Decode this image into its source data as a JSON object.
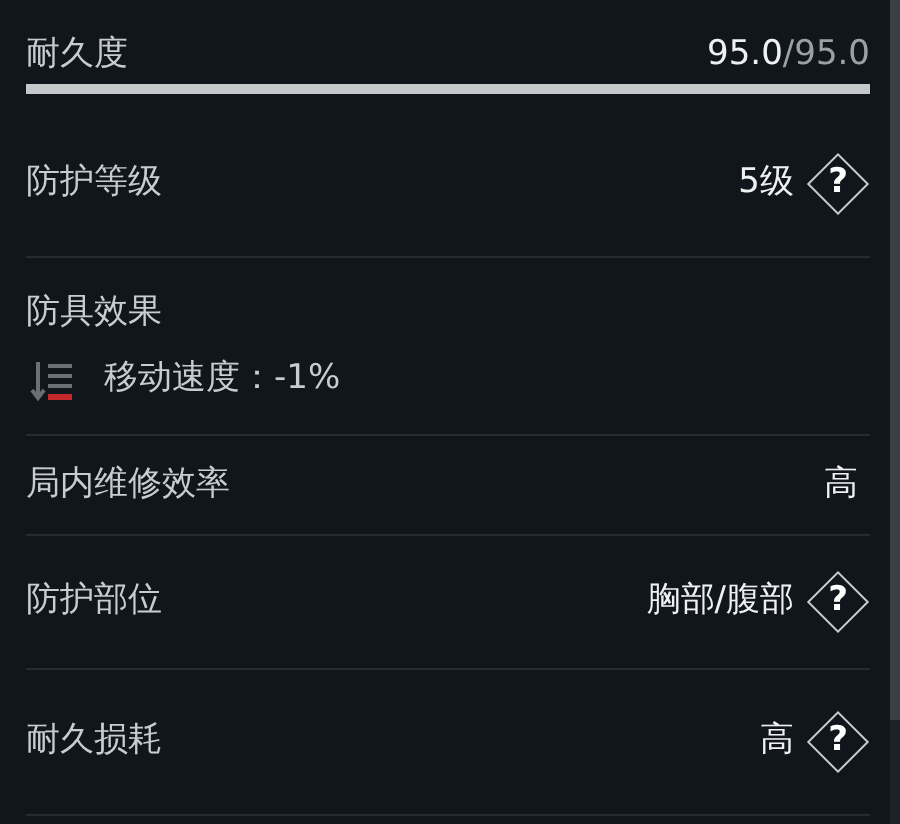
{
  "durability": {
    "label": "耐久度",
    "current": "95.0",
    "max": "/95.0",
    "level": 1
  },
  "rows": [
    {
      "kind": "stat",
      "label": "防护等级",
      "value": "5级",
      "help": "?"
    },
    {
      "kind": "effects",
      "label": "防具效果",
      "effects": [
        {
          "text": "移动速度：-1%"
        }
      ]
    },
    {
      "kind": "stat",
      "label": "局内维修效率",
      "value": "高"
    },
    {
      "kind": "stat",
      "label": "防护部位",
      "value": "胸部/腹部",
      "help": "?"
    },
    {
      "kind": "stat",
      "label": "耐久损耗",
      "value": "高",
      "help": "?"
    }
  ]
}
